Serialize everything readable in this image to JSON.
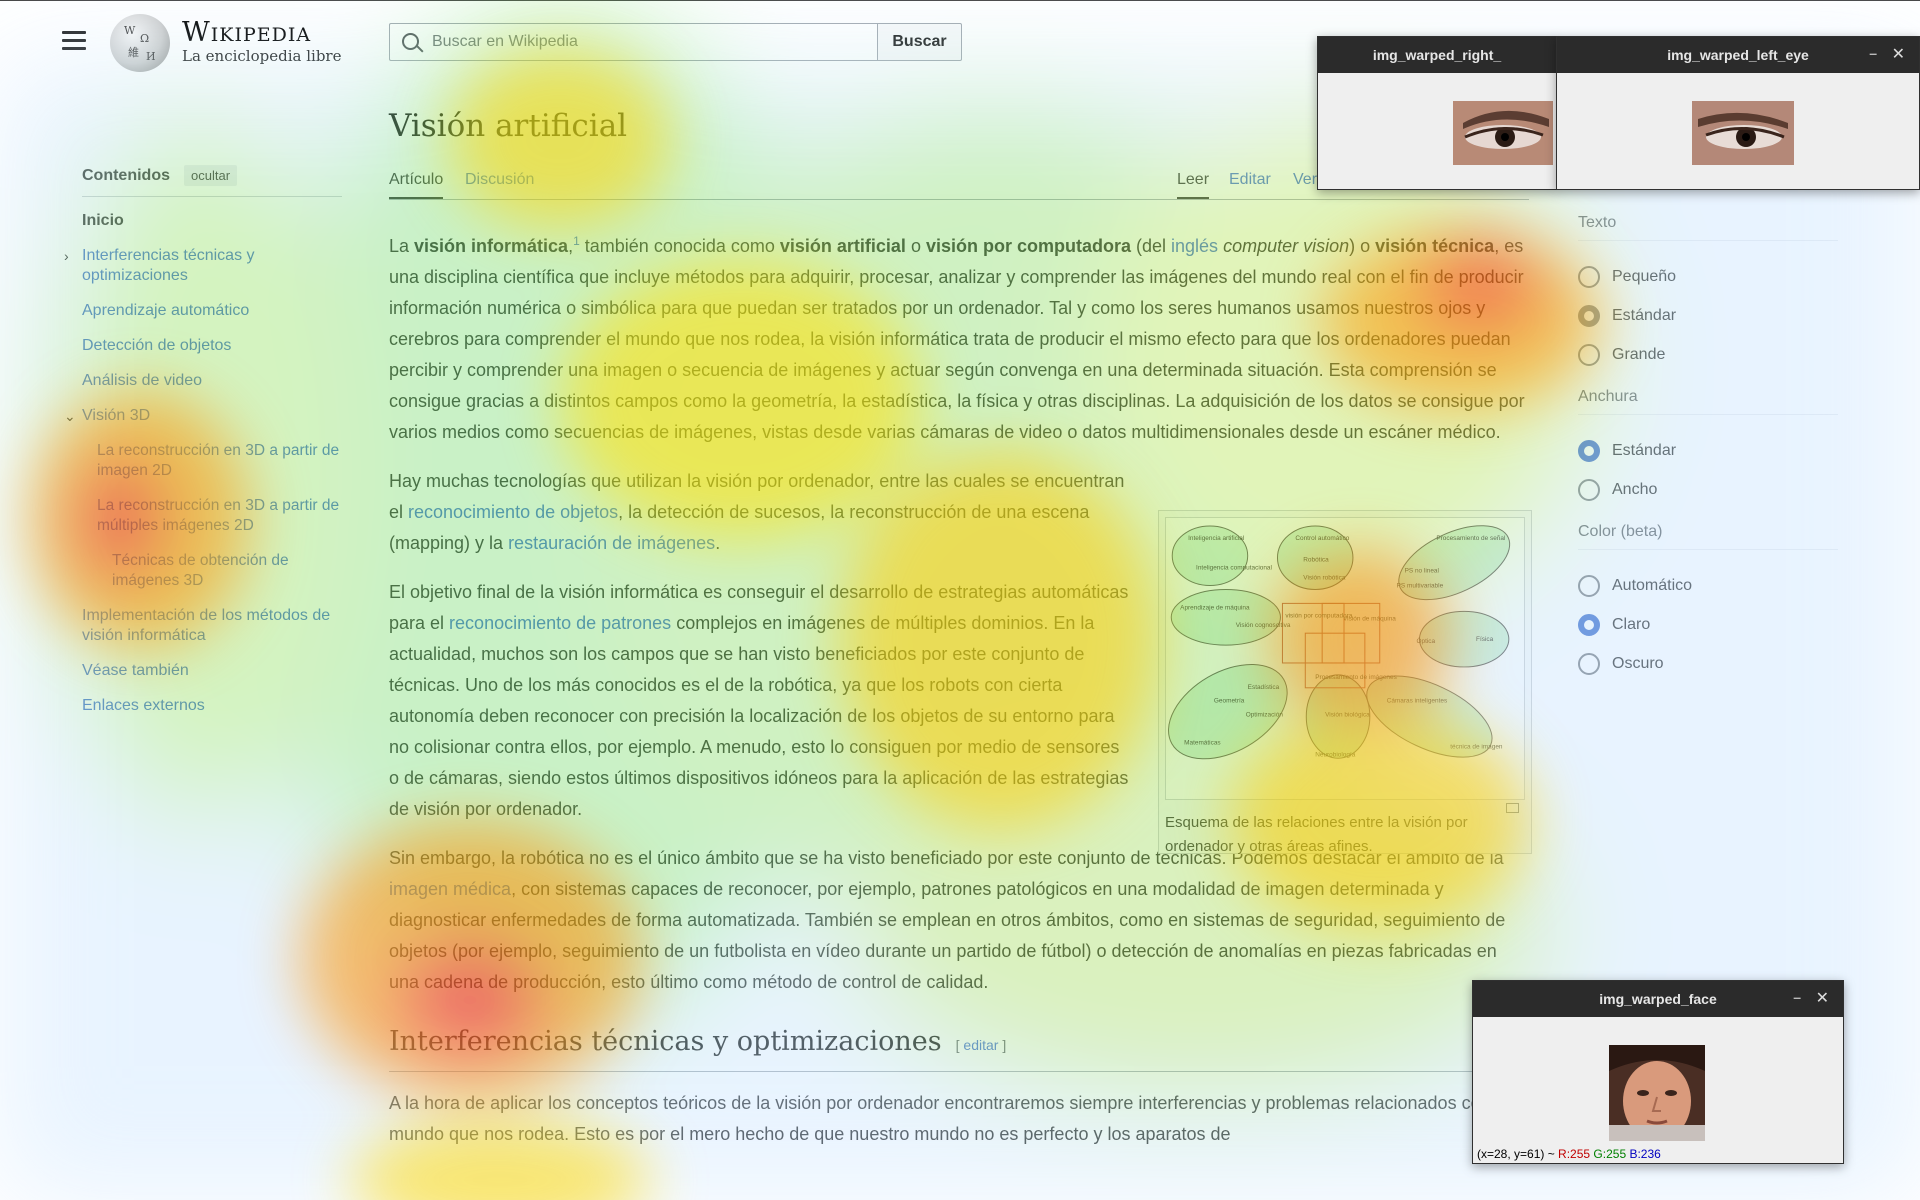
{
  "header": {
    "wordmark": "Wikipedia",
    "tagline": "La enciclopedia libre",
    "search_placeholder": "Buscar en Wikipedia",
    "search_button": "Buscar"
  },
  "toc": {
    "title": "Contenidos",
    "hide_label": "ocultar",
    "items": [
      {
        "label": "Inicio"
      },
      {
        "label": "Interferencias técnicas y optimizaciones"
      },
      {
        "label": "Aprendizaje automático"
      },
      {
        "label": "Detección de objetos"
      },
      {
        "label": "Análisis de video"
      },
      {
        "label": "Visión 3D"
      },
      {
        "label": "La reconstrucción en 3D a partir de imagen 2D"
      },
      {
        "label": "La reconstrucción en 3D a partir de múltiples imágenes 2D"
      },
      {
        "label": "Técnicas de obtención de imágenes 3D"
      },
      {
        "label": "Implementación de los métodos de visión informática"
      },
      {
        "label": "Véase también"
      },
      {
        "label": "Enlaces externos"
      }
    ]
  },
  "article": {
    "title": "Visión artificial",
    "tabs": {
      "article": "Artículo",
      "talk": "Discusión",
      "read": "Leer",
      "edit": "Editar",
      "history_partial": "Ver"
    },
    "p1": {
      "s1": "La ",
      "b1": "visión informática",
      "s2": ",",
      "ref": "1",
      "s3": " también conocida como ",
      "b2": "visión artificial",
      "s4": " o ",
      "b3": "visión por computadora",
      "s5": " (del ",
      "link1": "inglés",
      "s6": " ",
      "em1": "computer vision",
      "s7": ") o ",
      "b4": "visión técnica",
      "s8": ", es una disciplina científica que incluye métodos para adquirir, procesar, analizar y comprender las imágenes del mundo real con el fin de producir información numérica o simbólica para que puedan ser tratados por un ordenador. Tal y como los seres humanos usamos nuestros ojos y cerebros para comprender el mundo que nos rodea, la visión informática trata de producir el mismo efecto para que los ordenadores puedan percibir y comprender una imagen o secuencia de imágenes y actuar según convenga en una determinada situación. Esta comprensión se consigue gracias a distintos campos como la geometría, la estadística, la física y otras disciplinas. La adquisición de los datos se consigue por varios medios como secuencias de imágenes, vistas desde varias cámaras de video o datos multidimensionales desde un escáner médico."
    },
    "p2": {
      "s1": "Hay muchas tecnologías que utilizan la visión por ordenador, entre las cuales se encuentran el ",
      "link1": "reconocimiento de objetos",
      "s2": ", la detección de sucesos, la reconstrucción de una escena (mapping) y la ",
      "link2": "restauración de imágenes",
      "s3": "."
    },
    "p3": {
      "s1": "El objetivo final de la visión informática es conseguir el desarrollo de estrategias automáticas para el ",
      "link1": "reconocimiento de patrones",
      "s2": " complejos en imágenes de múltiples dominios. En la actualidad, muchos son los campos que se han visto beneficiados por este conjunto de técnicas. Uno de los más conocidos es el de la robótica, ya que los robots con cierta autonomía deben reconocer con precisión la localización de los objetos de su entorno para no colisionar contra ellos, por ejemplo. A menudo, esto lo consiguen por medio de sensores o de cámaras, siendo estos últimos dispositivos idóneos para la aplicación de las estrategias de visión por ordenador."
    },
    "p4": {
      "s1": "Sin embargo, la robótica no es el único ámbito que se ha visto beneficiado por este conjunto de técnicas. Podemos destacar el ámbito de la ",
      "link1": "imagen médica",
      "s2": ", con sistemas capaces de reconocer, por ejemplo, patrones patológicos en una modalidad de imagen determinada y diagnosticar enfermedades de forma automatizada. También se emplean en otros ámbitos, como en sistemas de seguridad, seguimiento de objetos (por ejemplo, seguimiento de un futbolista en vídeo durante un partido de fútbol) o detección de anomalías en piezas fabricadas en una cadena de producción, esto último como método de control de calidad."
    },
    "figure": {
      "caption": "Esquema de las relaciones entre la visión por ordenador y otras áreas afines.",
      "labels": {
        "ia": "Inteligencia artificial",
        "ic": "Inteligencia computacional",
        "ctrl": "Control automático",
        "rob": "Robótica",
        "vrob": "Visión robótica",
        "ps": "Procesamiento de señal",
        "psn": "PS no lineal",
        "psm": "PS multivariable",
        "ml": "Aprendizaje de máquina",
        "vc": "Visión cognoscitiva",
        "vpc": "visión por computadora",
        "vm": "Visión de máquina",
        "opt": "Óptica",
        "fis": "Física",
        "est": "Estadística",
        "geo": "Geometría",
        "optz": "Optimización",
        "mat": "Matemáticas",
        "pi": "Procesamiento de imágenes",
        "vb": "Visión biológica",
        "neu": "Neurobiología",
        "ci": "Cámaras inteligentes",
        "ti": "técnica de imagen"
      }
    },
    "section2": {
      "title": "Interferencias técnicas y optimizaciones",
      "edit": "editar",
      "text": "A la hora de aplicar los conceptos teóricos de la visión por ordenador encontraremos siempre interferencias y problemas relacionados con el mundo que nos rodea. Esto es por el mero hecho de que nuestro mundo no es perfecto y los aparatos de"
    }
  },
  "appearance": {
    "text_group": "Texto",
    "text_options": [
      "Pequeño",
      "Estándar",
      "Grande"
    ],
    "width_group": "Anchura",
    "width_options": [
      "Estándar",
      "Ancho"
    ],
    "color_group": "Color (beta)",
    "color_options": [
      "Automático",
      "Claro",
      "Oscuro"
    ]
  },
  "windows": {
    "right_eye_title": "img_warped_right_",
    "left_eye_title": "img_warped_left_eye",
    "face_title": "img_warped_face",
    "status": {
      "coords": "(x=28, y=61) ~ ",
      "r": "R:255",
      "g": "G:255",
      "b": "B:236"
    }
  }
}
